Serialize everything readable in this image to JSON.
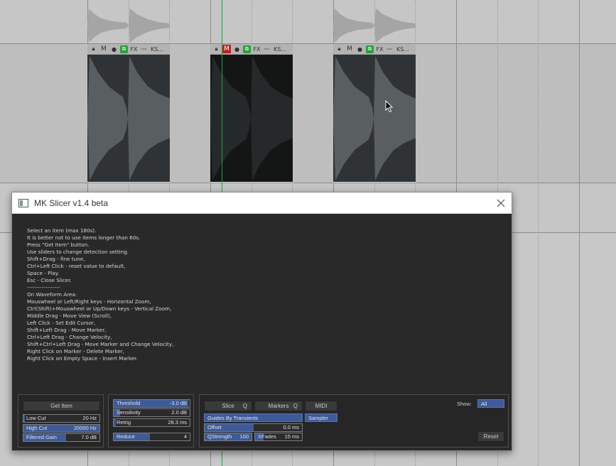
{
  "window": {
    "title": "MK Slicer v1.4 beta"
  },
  "help_lines": [
    "Select an item (max 180s).",
    "It is better not to use items longer than 60s.",
    "Press \"Get Item\" button.",
    "Use sliders to change detection setting.",
    "Shift+Drag - fine tune,",
    "Ctrl+Left Click - reset value to default,",
    "Space - Play.",
    "Esc - Close Slicer.",
    "------------------",
    "On Waveform Area:",
    "Mouswheel or Left/Right keys - Horizontal Zoom,",
    "Ctrl(Shift)+Mouswheel or Up/Down keys - Vertical Zoom,",
    "Middle Drag - Move View (Scroll),",
    "Left Click - Set Edit Cursor,",
    "Shift+Left Drag - Move Marker,",
    "Ctrl+Left Drag - Change Velocity,",
    "Shift+Ctrl+Left Drag - Move Marker and Change Velocity,",
    "Right Click on Marker - Delete Marker,",
    "Right Click on Empty Space - Insert Marker."
  ],
  "input_panel": {
    "get_item": "Get Item",
    "low_cut": {
      "label": "Low Cut",
      "value": "20 Hz",
      "fill": 0.02
    },
    "high_cut": {
      "label": "High Cut",
      "value": "20000 Hz",
      "fill": 1.0
    },
    "filtered_gain": {
      "label": "Filtered Gain",
      "value": "7.0 dB",
      "fill": 0.56
    }
  },
  "detect_panel": {
    "threshold": {
      "label": "Threshold",
      "value": "-3.0 dB",
      "fill": 0.98
    },
    "sensitivity": {
      "label": "Sensitivity",
      "value": "2.0 dB",
      "fill": 0.08
    },
    "retrig": {
      "label": "Retrig",
      "value": "28.3 ms",
      "fill": 0.03
    },
    "reduce": {
      "label": "Reduce",
      "value": "4",
      "fill": 0.48
    }
  },
  "mode_panel": {
    "slice": {
      "label": "Slice",
      "key": "Q"
    },
    "markers": {
      "label": "Markers",
      "key": "Q"
    },
    "midi": {
      "label": "MIDI"
    },
    "guides_select": "Guides By Transients",
    "sampler_select": "Sampler",
    "offset": {
      "label": "Offset",
      "value": "0.0 ms",
      "fill": 0.5
    },
    "qstrength": {
      "label": "QStrength",
      "value": "100",
      "fill": 1.0
    },
    "xfades": {
      "label": "XFades",
      "value": "15 ms",
      "fill": 0.18
    },
    "show_label": "Show:",
    "show_select": "All",
    "reset": "Reset"
  },
  "items": [
    {
      "label": "KS...",
      "muted": false
    },
    {
      "label": "KS...",
      "muted": true
    },
    {
      "label": "KS...",
      "muted": false
    }
  ],
  "colors": {
    "accent": "#3d5b9a",
    "playhead": "#1aa83a",
    "mute": "#c02020",
    "group": "#27a03a"
  }
}
